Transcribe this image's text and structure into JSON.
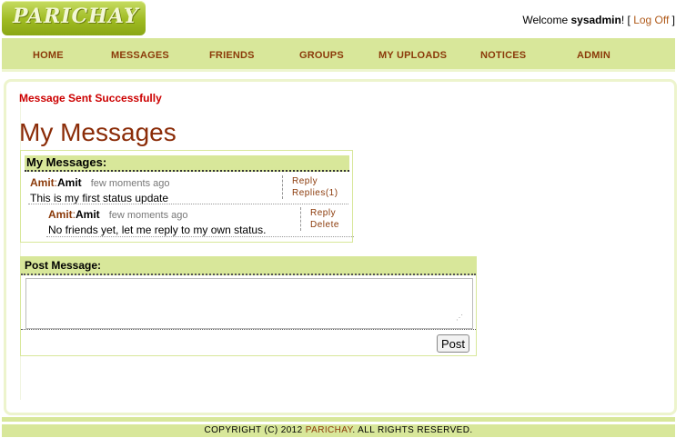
{
  "header": {
    "logo_text": "PARICHAY",
    "welcome_prefix": "Welcome ",
    "username": "sysadmin",
    "welcome_suffix": "! [ ",
    "logoff_label": "Log Off",
    "bracket_close": " ]"
  },
  "nav": {
    "items": [
      "HOME",
      "MESSAGES",
      "FRIENDS",
      "GROUPS",
      "MY UPLOADS",
      "NOTICES",
      "ADMIN"
    ]
  },
  "main": {
    "success_message": "Message Sent Successfully",
    "page_title": "My Messages",
    "messages_header": "My Messages:",
    "messages": [
      {
        "author": "Amit",
        "name": "Amit",
        "time": "few moments ago",
        "body": "This is my first status update",
        "reply_label": "Reply",
        "replies_label": "Replies(1)"
      },
      {
        "author": "Amit",
        "name": "Amit",
        "time": "few moments ago",
        "body": "No friends yet, let me reply to my own status.",
        "reply_label": "Reply",
        "delete_label": "Delete"
      }
    ],
    "post_header": "Post Message:",
    "post_value": "",
    "post_button": "Post"
  },
  "footer": {
    "prefix": "COPYRIGHT (C) 2012 ",
    "brand": "PARICHAY",
    "suffix": ". ALL RIGHTS RESERVED."
  },
  "colors": {
    "accent_green": "#d8e79a",
    "brand_brown": "#8b3a0a",
    "success_red": "#cc0000"
  }
}
